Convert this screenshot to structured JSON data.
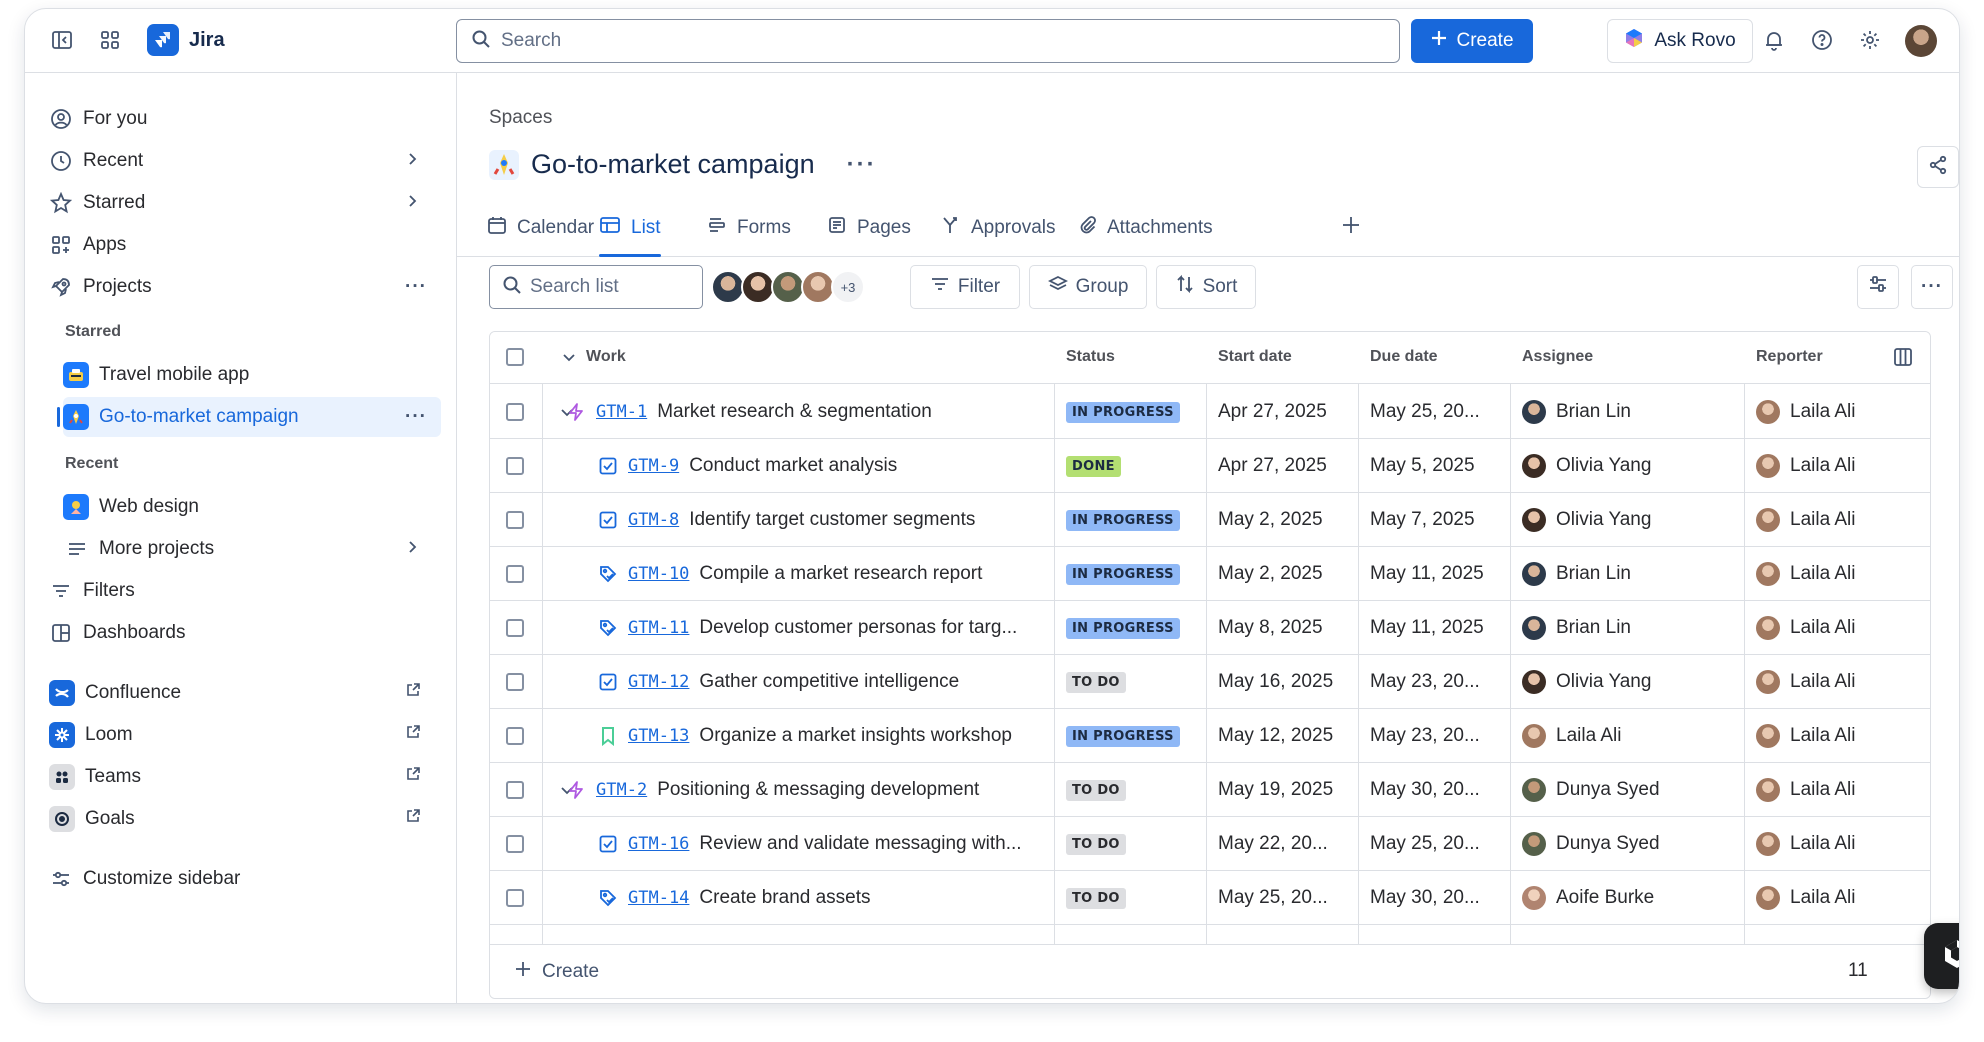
{
  "app": {
    "name": "Jira"
  },
  "topbar": {
    "search_placeholder": "Search",
    "create_label": "Create",
    "ask_rovo_label": "Ask Rovo"
  },
  "sidebar": {
    "for_you": "For you",
    "recent": "Recent",
    "starred": "Starred",
    "apps": "Apps",
    "projects": "Projects",
    "starred_heading": "Starred",
    "starred_projects": [
      "Travel mobile app",
      "Go-to-market campaign"
    ],
    "recent_heading": "Recent",
    "recent_projects": [
      "Web design"
    ],
    "more_projects": "More projects",
    "filters": "Filters",
    "dashboards": "Dashboards",
    "confluence": "Confluence",
    "loom": "Loom",
    "teams": "Teams",
    "goals": "Goals",
    "customize": "Customize sidebar"
  },
  "main": {
    "breadcrumb": "Spaces",
    "title": "Go-to-market campaign",
    "tabs": [
      "Calendar",
      "List",
      "Forms",
      "Pages",
      "Approvals",
      "Attachments"
    ],
    "search_list_placeholder": "Search list",
    "avatar_more": "+3",
    "filter_label": "Filter",
    "group_label": "Group",
    "sort_label": "Sort",
    "create_row_label": "Create",
    "footer_count": "11"
  },
  "table": {
    "headers": [
      "Work",
      "Status",
      "Start date",
      "Due date",
      "Assignee",
      "Reporter"
    ],
    "rows": [
      {
        "key": "GTM-1",
        "summary": "Market research & segmentation",
        "type": "epic",
        "child": false,
        "status": "IN PROGRESS",
        "start": "Apr 27, 2025",
        "due": "May 25, 20...",
        "assignee": "Brian Lin",
        "reporter": "Laila Ali"
      },
      {
        "key": "GTM-9",
        "summary": "Conduct market analysis",
        "type": "task",
        "child": true,
        "status": "DONE",
        "start": "Apr 27, 2025",
        "due": "May 5, 2025",
        "assignee": "Olivia Yang",
        "reporter": "Laila Ali"
      },
      {
        "key": "GTM-8",
        "summary": "Identify target customer segments",
        "type": "task",
        "child": true,
        "status": "IN PROGRESS",
        "start": "May 2, 2025",
        "due": "May 7, 2025",
        "assignee": "Olivia Yang",
        "reporter": "Laila Ali"
      },
      {
        "key": "GTM-10",
        "summary": "Compile a market research report",
        "type": "deliverable",
        "child": true,
        "status": "IN PROGRESS",
        "start": "May 2, 2025",
        "due": "May 11, 2025",
        "assignee": "Brian Lin",
        "reporter": "Laila Ali"
      },
      {
        "key": "GTM-11",
        "summary": "Develop customer personas for targ...",
        "type": "deliverable",
        "child": true,
        "status": "IN PROGRESS",
        "start": "May 8, 2025",
        "due": "May 11, 2025",
        "assignee": "Brian Lin",
        "reporter": "Laila Ali"
      },
      {
        "key": "GTM-12",
        "summary": "Gather competitive intelligence",
        "type": "task",
        "child": true,
        "status": "TO DO",
        "start": "May 16, 2025",
        "due": "May 23, 20...",
        "assignee": "Olivia Yang",
        "reporter": "Laila Ali"
      },
      {
        "key": "GTM-13",
        "summary": "Organize a market insights workshop",
        "type": "story",
        "child": true,
        "status": "IN PROGRESS",
        "start": "May 12, 2025",
        "due": "May 23, 20...",
        "assignee": "Laila Ali",
        "reporter": "Laila Ali"
      },
      {
        "key": "GTM-2",
        "summary": "Positioning & messaging development",
        "type": "epic",
        "child": false,
        "status": "TO DO",
        "start": "May 19, 2025",
        "due": "May 30, 20...",
        "assignee": "Dunya Syed",
        "reporter": "Laila Ali"
      },
      {
        "key": "GTM-16",
        "summary": "Review and validate messaging with...",
        "type": "task",
        "child": true,
        "status": "TO DO",
        "start": "May 22, 20...",
        "due": "May 25, 20...",
        "assignee": "Dunya Syed",
        "reporter": "Laila Ali"
      },
      {
        "key": "GTM-14",
        "summary": "Create brand assets",
        "type": "deliverable",
        "child": true,
        "status": "TO DO",
        "start": "May 25, 20...",
        "due": "May 30, 20...",
        "assignee": "Aoife Burke",
        "reporter": "Laila Ali"
      }
    ]
  },
  "colors": {
    "brand": "#1868DB",
    "in_progress": "#8FB8F6",
    "done": "#B3DF72",
    "to_do": "#DDDEE1"
  },
  "icons": {
    "epic": "lightning-icon",
    "task": "checkbox-task-icon",
    "deliverable": "deliverable-icon",
    "story": "bookmark-icon"
  }
}
